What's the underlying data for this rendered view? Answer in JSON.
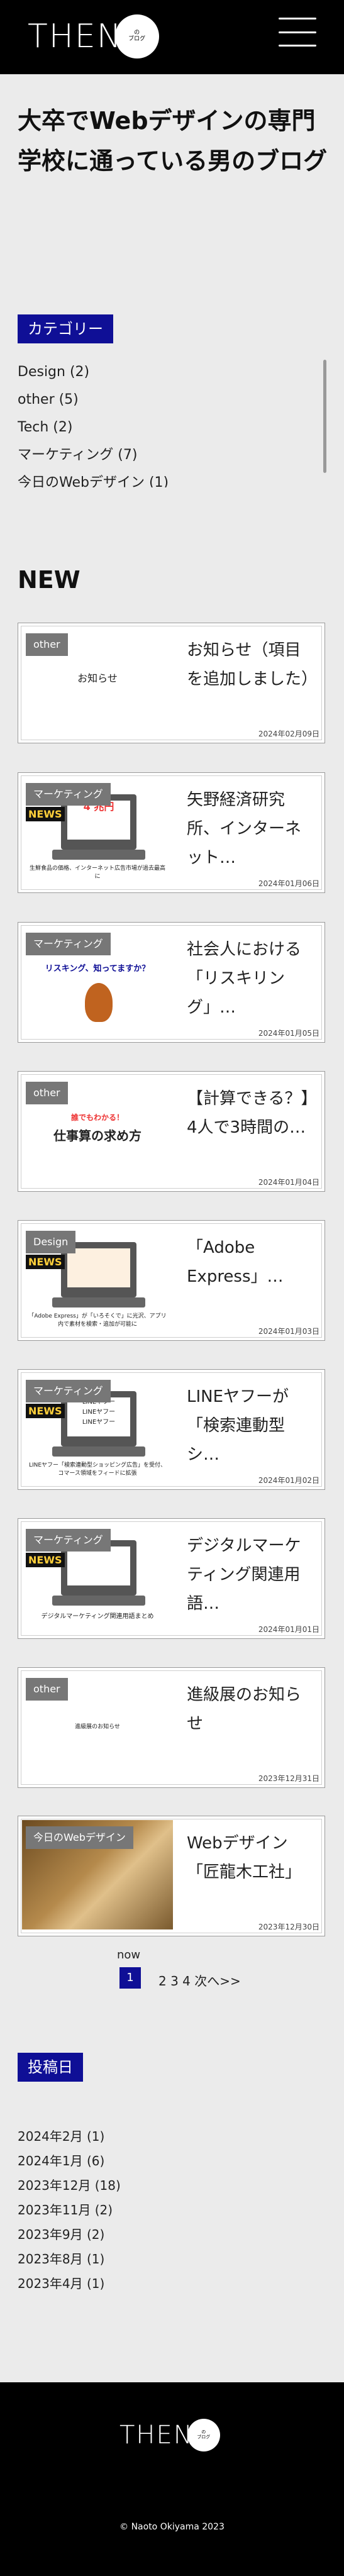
{
  "header": {
    "logo_text": "THEN",
    "logo_badge_line1": "の",
    "logo_badge_line2": "ブログ"
  },
  "site_title": "大卒でWebデザインの専門学校に通っている男のブログ",
  "categories": {
    "heading": "カテゴリー",
    "items": [
      "Design (2)",
      "other (5)",
      "Tech (2)",
      "マーケティング (7)",
      "今日のWebデザイン (1)"
    ]
  },
  "new_section": {
    "heading": "NEW",
    "posts": [
      {
        "category": "other",
        "thumb_text": "お知らせ",
        "title": "お知らせ（項目を追加しました）",
        "date": "2024年02月09日"
      },
      {
        "category": "マーケティング",
        "thumb_text": "生鮮食品の価格、インターネット広告市場が過去最高に",
        "thumb_price": "4 兆円",
        "title": "矢野経済研究所、インターネット…",
        "date": "2024年01月06日"
      },
      {
        "category": "マーケティング",
        "thumb_text": "リスキング、知ってますか？",
        "title": "社会人における「リスキリング」…",
        "date": "2024年01月05日"
      },
      {
        "category": "other",
        "thumb_text": "仕事算の求め方",
        "thumb_sub": "誰でもわかる！",
        "title": "【計算できる？】4人で3時間の…",
        "date": "2024年01月04日"
      },
      {
        "category": "Design",
        "thumb_text": "「Adobe Express」が「いろそくで」に光沢、アプリ内で素材を検索・追加が可能に",
        "title": "「Adobe Express」…",
        "date": "2024年01月03日"
      },
      {
        "category": "マーケティング",
        "thumb_text": "LINEヤフー「検索連動型ショッピング広告」を受付、コマース領域をフィードに拡張",
        "title": "LINEヤフーが「検索連動型シ…",
        "date": "2024年01月02日"
      },
      {
        "category": "マーケティング",
        "thumb_text": "デジタルマーケティング関連用語まとめ",
        "title": "デジタルマーケティング関連用語…",
        "date": "2024年01月01日"
      },
      {
        "category": "other",
        "thumb_text": "進級展のお知らせ",
        "title": "進級展のお知らせ",
        "date": "2023年12月31日"
      },
      {
        "category": "今日のWebデザイン",
        "thumb_text": "",
        "title": "Webデザイン「匠龍木工社」",
        "date": "2023年12月30日"
      }
    ]
  },
  "pagination": {
    "label": "now",
    "current": "1",
    "others": "2 3 4 次へ>>"
  },
  "archive": {
    "heading": "投稿日",
    "items": [
      "2024年2月 (1)",
      "2024年1月 (6)",
      "2023年12月 (18)",
      "2023年11月 (2)",
      "2023年9月 (2)",
      "2023年8月 (1)",
      "2023年4月 (1)"
    ]
  },
  "footer": {
    "logo_text": "THEN",
    "copyright": "© Naoto Okiyama 2023"
  },
  "colors": {
    "accent": "#0f0f96",
    "header_bg": "#000000",
    "page_bg": "#ebebeb"
  }
}
